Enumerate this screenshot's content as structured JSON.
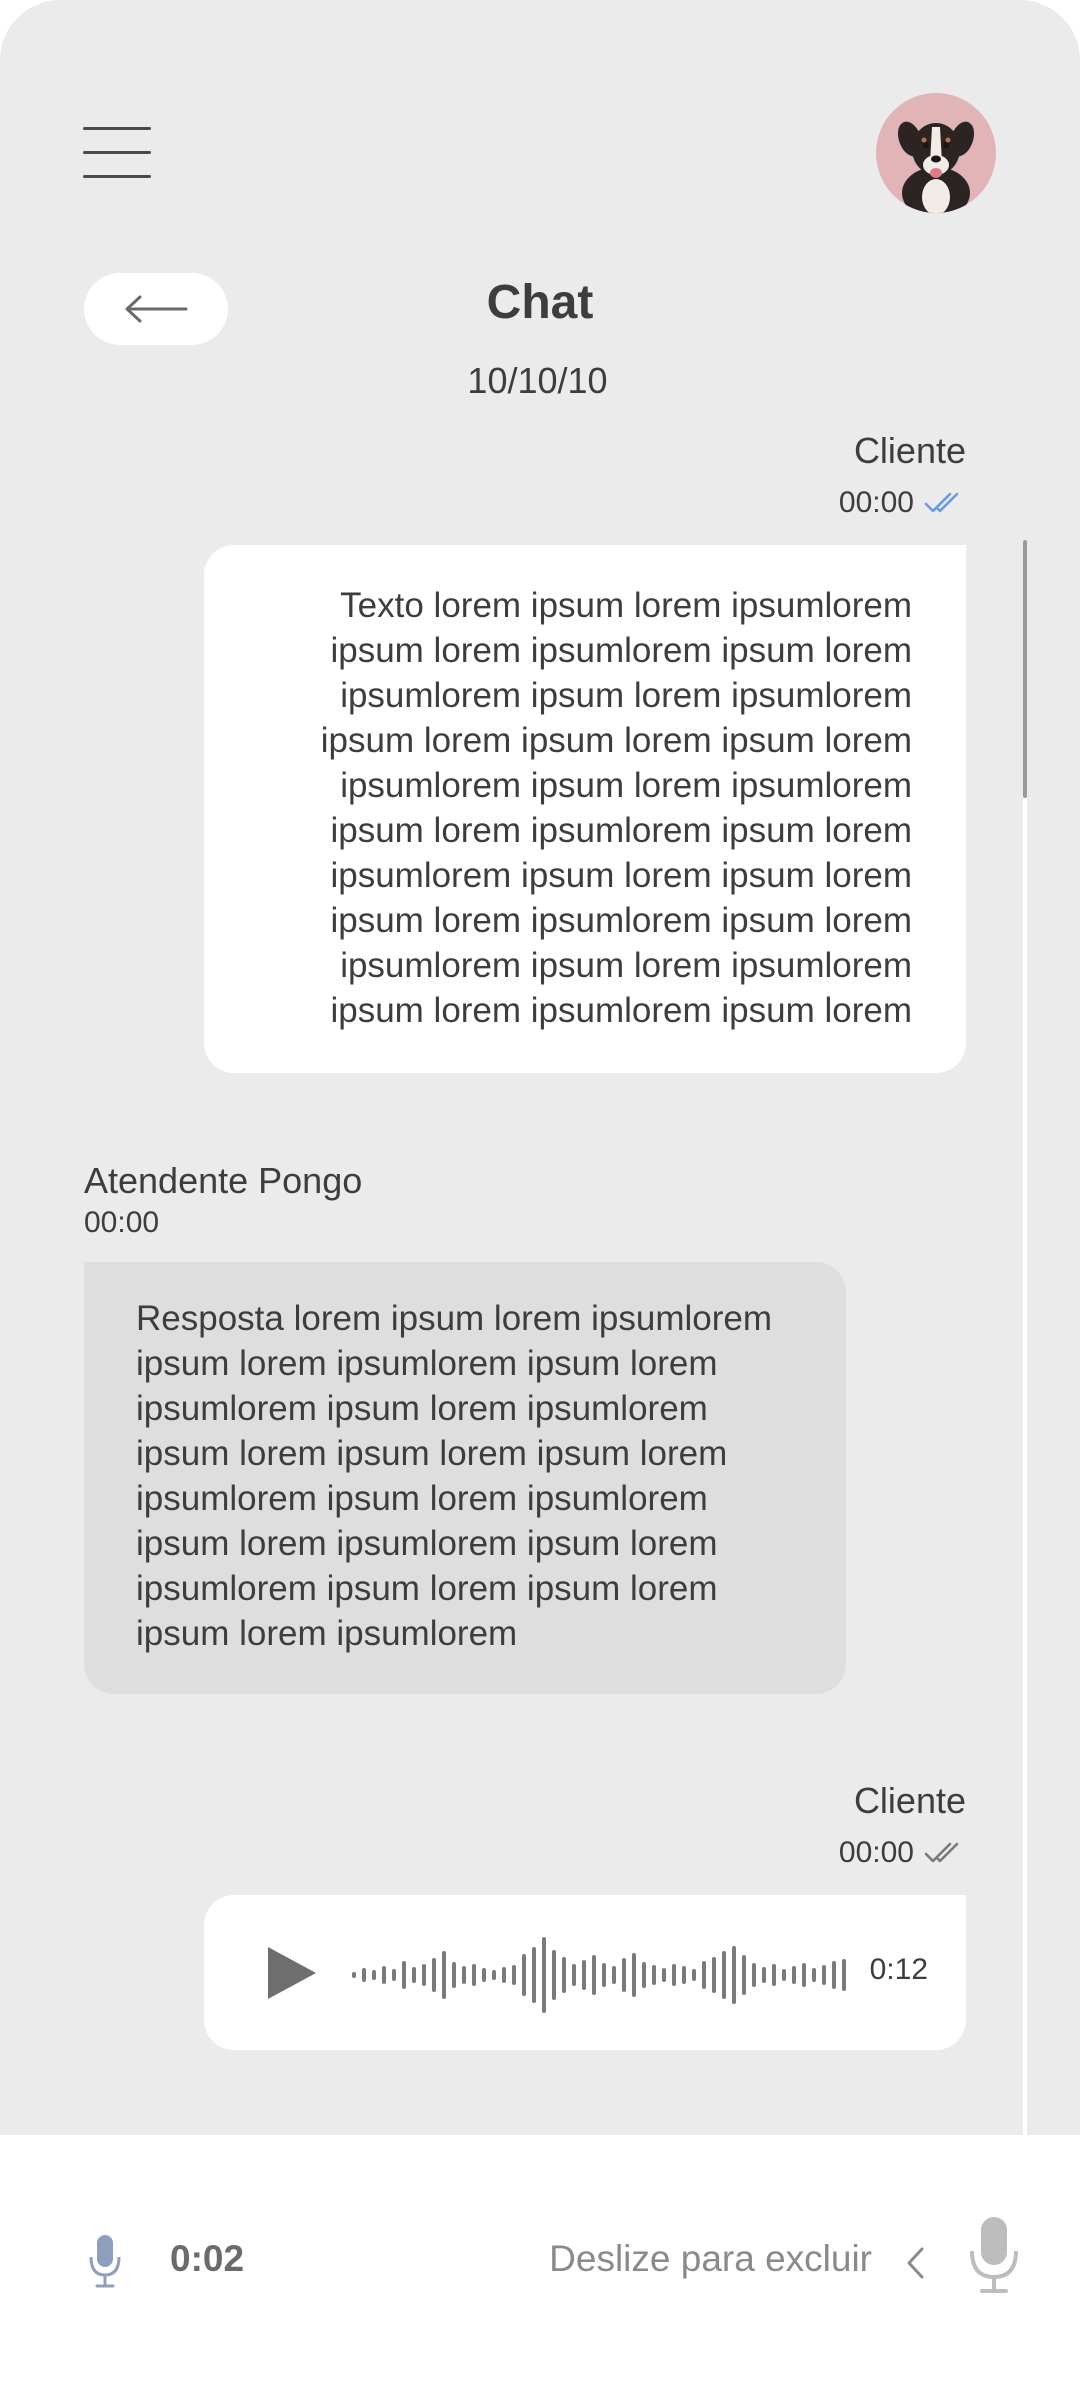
{
  "header": {
    "title": "Chat",
    "date": "10/10/10"
  },
  "messages": [
    {
      "sender": "Cliente",
      "time": "00:00",
      "status": "read",
      "status_color": "#6b9be8",
      "text": "Texto lorem ipsum  lorem ipsumlorem\nipsum  lorem ipsumlorem ipsum  lorem\nipsumlorem ipsum  lorem ipsumlorem\nipsum  lorem ipsum lorem ipsum  lorem\nipsumlorem ipsum  lorem ipsumlorem\nipsum  lorem ipsumlorem ipsum  lorem\nipsumlorem ipsum  lorem ipsum lorem\nipsum  lorem ipsumlorem ipsum  lorem\nipsumlorem ipsum  lorem ipsumlorem\nipsum  lorem ipsumlorem ipsum  lorem"
    },
    {
      "sender": "Atendente Pongo",
      "time": "00:00",
      "text": "Resposta lorem ipsum  lorem ipsumlorem\nipsum  lorem ipsumlorem ipsum  lorem\nipsumlorem ipsum  lorem ipsumlorem\nipsum  lorem ipsum lorem ipsum  lorem\nipsumlorem ipsum  lorem ipsumlorem\nipsum  lorem ipsumlorem ipsum  lorem\nipsumlorem ipsum  lorem ipsum lorem\nipsum  lorem ipsumlorem"
    },
    {
      "sender": "Cliente",
      "time": "00:00",
      "status": "delivered",
      "status_color": "#7a7a7a",
      "audio_duration": "0:12"
    }
  ],
  "recorder": {
    "elapsed": "0:02",
    "hint": "Deslize para excluir"
  },
  "icons": {
    "menu": "menu-icon",
    "back": "arrow-left-icon",
    "read_receipt": "double-check-icon",
    "play": "play-icon",
    "mic": "microphone-icon",
    "chevron": "chevron-left-icon"
  },
  "colors": {
    "background": "#ebebeb",
    "client_bubble": "#ffffff",
    "agent_bubble": "#dedede",
    "accent_read": "#6b9be8"
  }
}
